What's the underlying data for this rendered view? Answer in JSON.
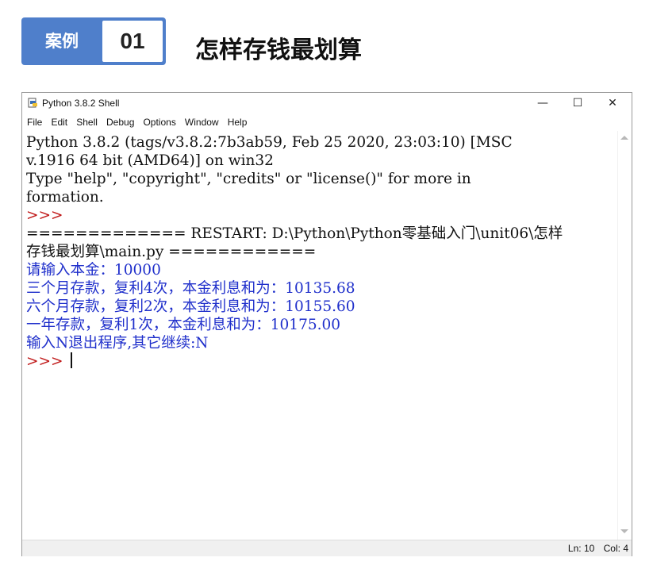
{
  "header": {
    "case_label": "案例",
    "case_number": "01",
    "title": "怎样存钱最划算"
  },
  "window": {
    "title": "Python 3.8.2 Shell",
    "controls": {
      "minimize": "—",
      "maximize": "☐",
      "close": "✕"
    }
  },
  "menu": {
    "items": [
      "File",
      "Edit",
      "Shell",
      "Debug",
      "Options",
      "Window",
      "Help"
    ]
  },
  "shell": {
    "lines": [
      {
        "text": "Python 3.8.2 (tags/v3.8.2:7b3ab59, Feb 25 2020, 23:03:10) [MSC",
        "color": "#111111"
      },
      {
        "text": "v.1916 64 bit (AMD64)] on win32",
        "color": "#111111"
      },
      {
        "text": "Type \"help\", \"copyright\", \"credits\" or \"license()\" for more in",
        "color": "#111111"
      },
      {
        "text": "formation.",
        "color": "#111111"
      },
      {
        "text": ">>> ",
        "color": "#c01818"
      },
      {
        "text": "============= RESTART: D:\\Python\\Python零基础入门\\unit06\\怎样",
        "color": "#111111"
      },
      {
        "text": "存钱最划算\\main.py ============",
        "color": "#111111"
      },
      {
        "text": "请输入本金：10000",
        "color": "#1f2fcb",
        "input": "10000"
      },
      {
        "text": "三个月存款，复利4次，本金利息和为：10135.68",
        "color": "#1f2fcb"
      },
      {
        "text": "六个月存款，复利2次，本金利息和为：10155.60",
        "color": "#1f2fcb"
      },
      {
        "text": "一年存款，复利1次，本金利息和为：10175.00",
        "color": "#1f2fcb"
      },
      {
        "text": "输入N退出程序,其它继续:N",
        "color": "#1f2fcb",
        "input": "N"
      },
      {
        "text": ">>> ",
        "color": "#c01818",
        "cursor": true
      }
    ],
    "prompt": ">>> "
  },
  "status": {
    "line": "Ln: 10",
    "col": "Col: 4"
  },
  "colors": {
    "banner": "#4f7fcb",
    "output_blue": "#1f2fcb",
    "prompt_red": "#c01818",
    "status_bg": "#f0f0f0"
  }
}
